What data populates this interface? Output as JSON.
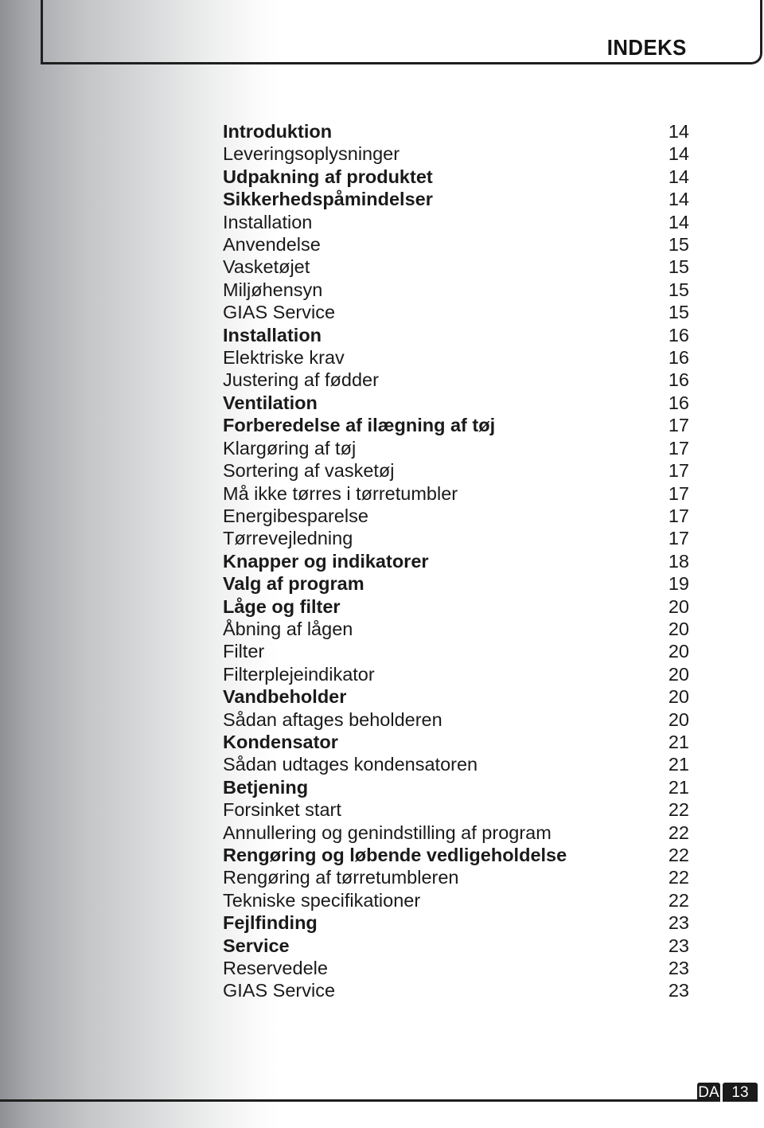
{
  "header": {
    "title": "INDEKS"
  },
  "toc": [
    {
      "label": "Introduktion",
      "page": "14",
      "bold": true
    },
    {
      "label": "Leveringsoplysninger",
      "page": "14",
      "bold": false
    },
    {
      "label": "Udpakning af produktet",
      "page": "14",
      "bold": true
    },
    {
      "label": "Sikkerhedspåmindelser",
      "page": "14",
      "bold": true
    },
    {
      "label": "Installation",
      "page": "14",
      "bold": false
    },
    {
      "label": "Anvendelse",
      "page": "15",
      "bold": false
    },
    {
      "label": "Vasketøjet",
      "page": "15",
      "bold": false
    },
    {
      "label": "Miljøhensyn",
      "page": "15",
      "bold": false
    },
    {
      "label": "GIAS Service",
      "page": "15",
      "bold": false
    },
    {
      "label": "Installation",
      "page": "16",
      "bold": true
    },
    {
      "label": "Elektriske krav",
      "page": "16",
      "bold": false
    },
    {
      "label": "Justering af fødder",
      "page": "16",
      "bold": false
    },
    {
      "label": "Ventilation",
      "page": "16",
      "bold": true
    },
    {
      "label": "Forberedelse af ilægning af tøj",
      "page": "17",
      "bold": true
    },
    {
      "label": "Klargøring af tøj",
      "page": "17",
      "bold": false
    },
    {
      "label": "Sortering af vasketøj",
      "page": "17",
      "bold": false
    },
    {
      "label": "Må ikke tørres i tørretumbler",
      "page": "17",
      "bold": false
    },
    {
      "label": "Energibesparelse",
      "page": "17",
      "bold": false
    },
    {
      "label": "Tørrevejledning",
      "page": "17",
      "bold": false
    },
    {
      "label": "Knapper og indikatorer",
      "page": "18",
      "bold": true
    },
    {
      "label": "Valg af program",
      "page": "19",
      "bold": true
    },
    {
      "label": "Låge og filter",
      "page": "20",
      "bold": true
    },
    {
      "label": "Åbning af lågen",
      "page": "20",
      "bold": false
    },
    {
      "label": "Filter",
      "page": "20",
      "bold": false
    },
    {
      "label": "Filterplejeindikator",
      "page": "20",
      "bold": false
    },
    {
      "label": "Vandbeholder",
      "page": "20",
      "bold": true
    },
    {
      "label": "Sådan aftages beholderen",
      "page": "20",
      "bold": false
    },
    {
      "label": "Kondensator",
      "page": "21",
      "bold": true
    },
    {
      "label": "Sådan udtages kondensatoren",
      "page": "21",
      "bold": false
    },
    {
      "label": "Betjening",
      "page": "21",
      "bold": true
    },
    {
      "label": "Forsinket start",
      "page": "22",
      "bold": false
    },
    {
      "label": "Annullering og genindstilling af program",
      "page": "22",
      "bold": false
    },
    {
      "label": "Rengøring og løbende vedligeholdelse",
      "page": "22",
      "bold": true
    },
    {
      "label": "Rengøring af tørretumbleren",
      "page": "22",
      "bold": false
    },
    {
      "label": "Tekniske specifikationer",
      "page": "22",
      "bold": false
    },
    {
      "label": "Fejlfinding",
      "page": "23",
      "bold": true
    },
    {
      "label": "Service",
      "page": "23",
      "bold": true
    },
    {
      "label": "Reservedele",
      "page": "23",
      "bold": false
    },
    {
      "label": "GIAS Service",
      "page": "23",
      "bold": false
    }
  ],
  "footer": {
    "language": "DA",
    "page_number": "13"
  }
}
